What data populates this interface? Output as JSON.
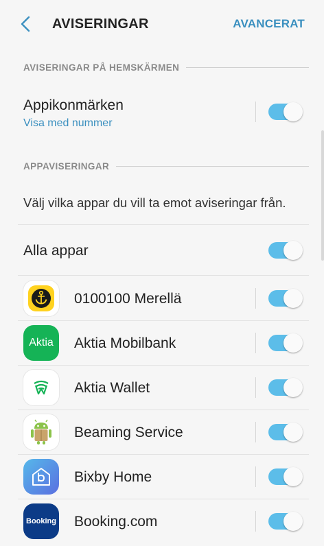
{
  "header": {
    "title": "AVISERINGAR",
    "advanced_label": "AVANCERAT",
    "back_icon": "chevron-left-icon"
  },
  "home_section": {
    "heading": "AVISERINGAR PÅ HEMSKÄRMEN",
    "item": {
      "label": "Appikonmärken",
      "sublabel": "Visa med nummer",
      "enabled": true
    }
  },
  "apps_section": {
    "heading": "APPAVISERINGAR",
    "description": "Välj vilka appar du vill ta emot aviseringar från.",
    "all_apps": {
      "label": "Alla appar",
      "enabled": true
    },
    "apps": [
      {
        "name": "0100100 Merellä",
        "icon": "anchor-icon",
        "enabled": true
      },
      {
        "name": "Aktia Mobilbank",
        "icon": "aktia-icon",
        "icon_text": "Aktia",
        "enabled": true
      },
      {
        "name": "Aktia Wallet",
        "icon": "wallet-wifi-icon",
        "enabled": true
      },
      {
        "name": "Beaming Service",
        "icon": "android-box-icon",
        "enabled": true
      },
      {
        "name": "Bixby Home",
        "icon": "bixby-home-icon",
        "enabled": true
      },
      {
        "name": "Booking.com",
        "icon": "booking-icon",
        "icon_text": "Booking",
        "enabled": true
      }
    ]
  },
  "colors": {
    "accent": "#3a8fbf",
    "toggle_on": "#5cbde9",
    "background": "#f6f6f6"
  }
}
